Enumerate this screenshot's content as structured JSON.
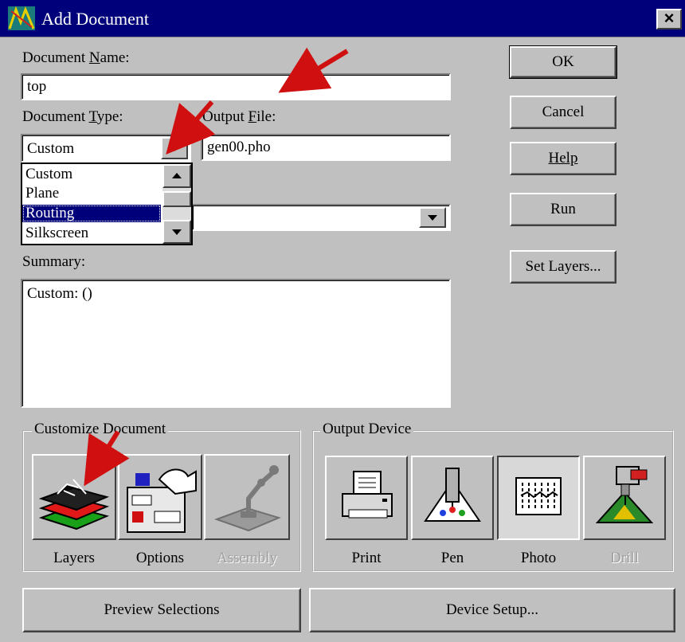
{
  "window": {
    "title": "Add Document"
  },
  "document_name": {
    "label": "Document Name:",
    "underline_char": "N",
    "value": "top"
  },
  "document_type": {
    "label": "Document Type:",
    "underline_char": "T",
    "value": "Custom",
    "options": [
      "Custom",
      "Plane",
      "Routing",
      "Silkscreen"
    ],
    "highlighted": "Routing"
  },
  "output_file": {
    "label": "Output File:",
    "underline_char": "F",
    "value": "gen00.pho"
  },
  "summary": {
    "label": "Summary:",
    "value": "Custom: ()"
  },
  "buttons": {
    "ok": "OK",
    "cancel": "Cancel",
    "help": "Help",
    "run": "Run",
    "set_layers": "Set Layers..."
  },
  "customize_document": {
    "title": "Customize Document",
    "items": [
      {
        "label": "Layers",
        "icon": "layers-icon",
        "enabled": true
      },
      {
        "label": "Options",
        "icon": "options-icon",
        "enabled": true
      },
      {
        "label": "Assembly",
        "icon": "assembly-icon",
        "enabled": false
      }
    ]
  },
  "output_device": {
    "title": "Output Device",
    "items": [
      {
        "label": "Print",
        "icon": "printer-icon",
        "enabled": true
      },
      {
        "label": "Pen",
        "icon": "pen-plotter-icon",
        "enabled": true
      },
      {
        "label": "Photo",
        "icon": "photo-plotter-icon",
        "enabled": true,
        "selected": true
      },
      {
        "label": "Drill",
        "icon": "drill-icon",
        "enabled": false
      }
    ]
  },
  "bottom_buttons": {
    "preview": "Preview Selections",
    "device_setup": "Device Setup..."
  },
  "colors": {
    "title_bar": "#00007b",
    "dialog_face": "#c0c0c0",
    "selection": "#00007b",
    "annotation_arrow": "#d01010"
  }
}
